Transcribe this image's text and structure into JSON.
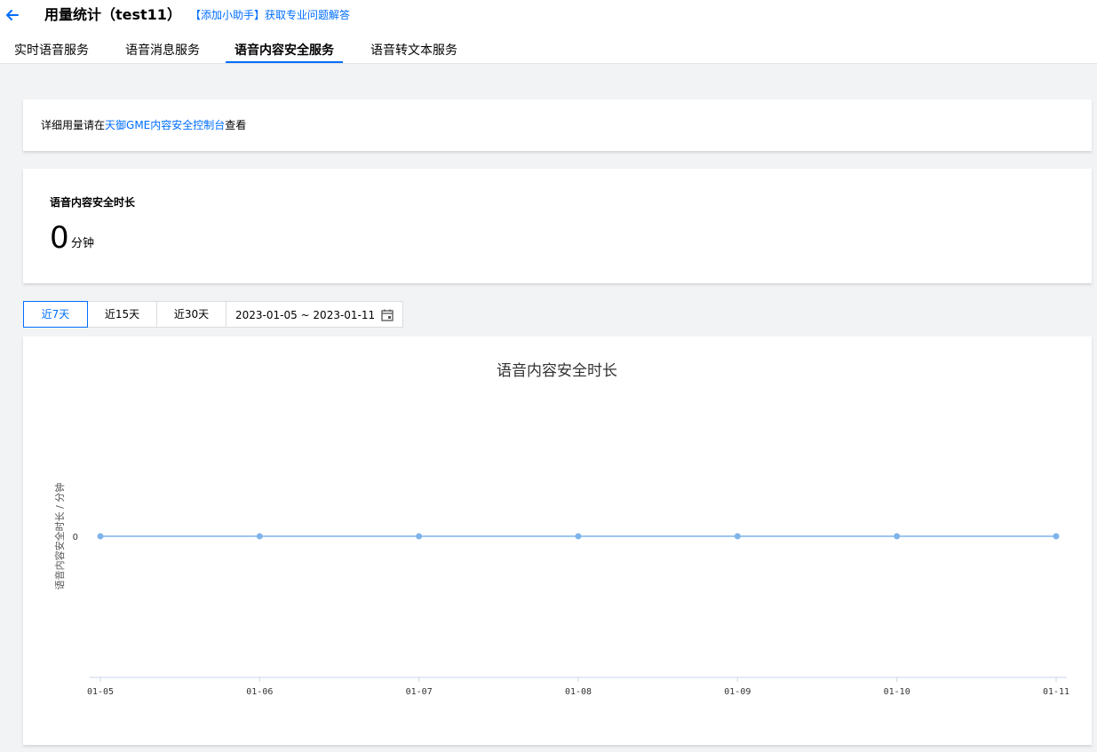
{
  "header": {
    "title": "用量统计（test11）",
    "helper_link": "【添加小助手】获取专业问题解答"
  },
  "tabs": [
    {
      "label": "实时语音服务"
    },
    {
      "label": "语音消息服务"
    },
    {
      "label": "语音内容安全服务",
      "active": true
    },
    {
      "label": "语音转文本服务"
    }
  ],
  "notice": {
    "prefix": "详细用量请在",
    "link": "天御GME内容安全控制台",
    "suffix": "查看"
  },
  "metric": {
    "label": "语音内容安全时长",
    "value": "0",
    "unit": "分钟"
  },
  "range_buttons": [
    {
      "label": "近7天",
      "active": true
    },
    {
      "label": "近15天"
    },
    {
      "label": "近30天"
    }
  ],
  "date_range": "2023-01-05 ~ 2023-01-11",
  "accent_color": "#006eff",
  "chart_data": {
    "type": "line",
    "title": "语音内容安全时长",
    "ylabel": "语音内容安全时长 / 分钟",
    "xlabel": "",
    "categories": [
      "01-05",
      "01-06",
      "01-07",
      "01-08",
      "01-09",
      "01-10",
      "01-11"
    ],
    "series": [
      {
        "values": [
          0,
          0,
          0,
          0,
          0,
          0,
          0
        ]
      }
    ],
    "y_ticks": [
      "0"
    ],
    "line_color": "#7fb4ea",
    "grid": false
  }
}
